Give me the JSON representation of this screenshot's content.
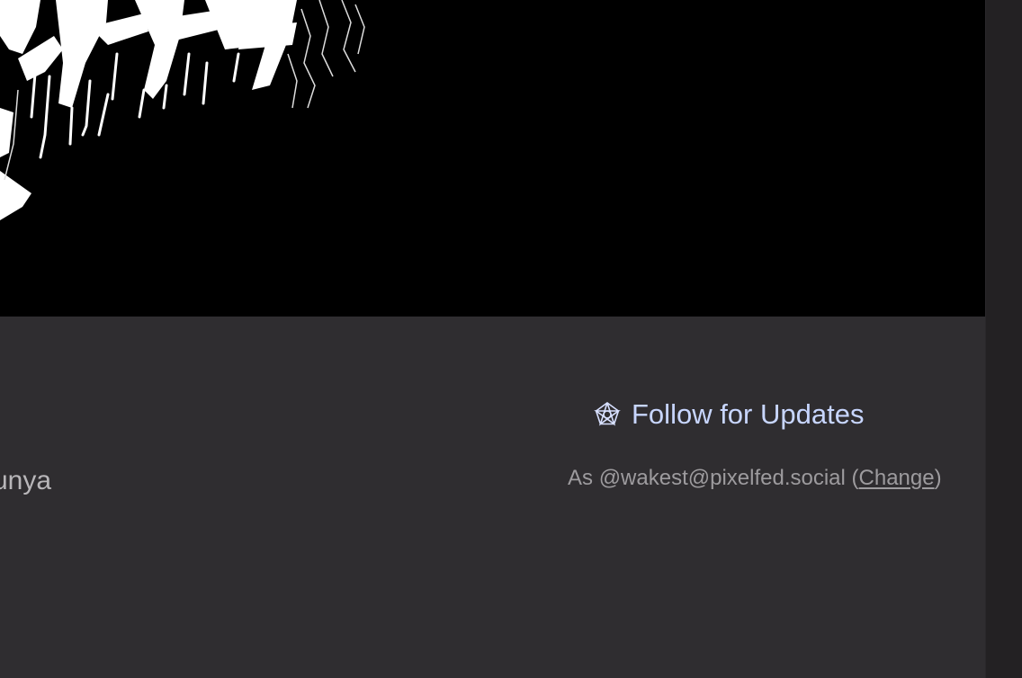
{
  "artist": {
    "name_partial": "unya"
  },
  "follow": {
    "button_label": "Follow for Updates",
    "icon": "fediverse-pentagram-icon",
    "account_prefix": "As ",
    "account_handle": "@wakest@pixelfed.social",
    "open_paren": " (",
    "change_label": "Change",
    "close_paren": ")"
  },
  "colors": {
    "accent": "#c8d6ff",
    "background": "#2f2d30",
    "banner": "#000000"
  }
}
